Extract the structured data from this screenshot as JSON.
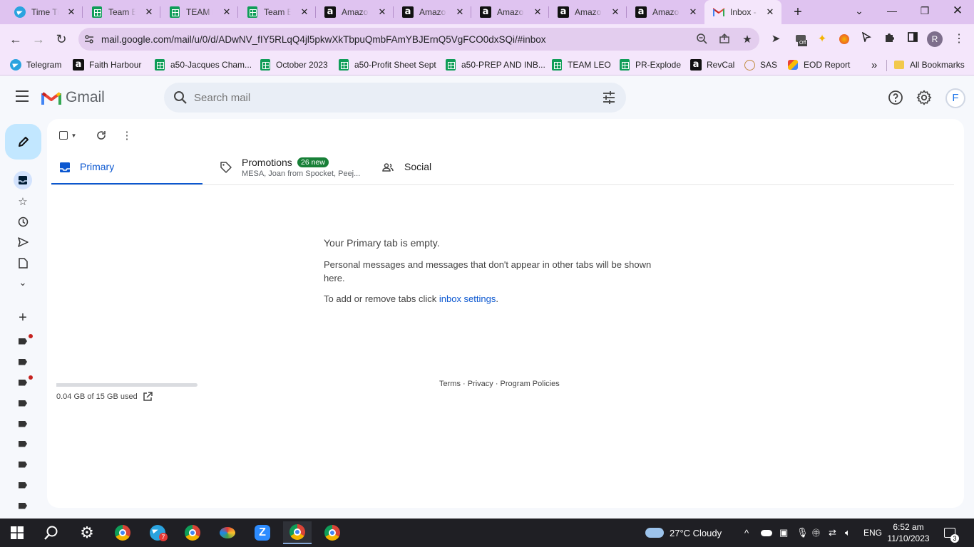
{
  "browser": {
    "tabs": [
      {
        "label": "Time Tr",
        "icon": "telegram-icon"
      },
      {
        "label": "Team Ex",
        "icon": "sheets-icon"
      },
      {
        "label": "TEAM L",
        "icon": "sheets-icon"
      },
      {
        "label": "Team Ex",
        "icon": "sheets-icon"
      },
      {
        "label": "Amazon",
        "icon": "amazon-icon"
      },
      {
        "label": "Amazon",
        "icon": "amazon-icon"
      },
      {
        "label": "Amazon",
        "icon": "amazon-icon"
      },
      {
        "label": "Amazon",
        "icon": "amazon-icon"
      },
      {
        "label": "Amazon",
        "icon": "amazon-icon"
      },
      {
        "label": "Inbox -",
        "icon": "gmail-icon",
        "active": true
      }
    ],
    "url": "mail.google.com/mail/u/0/d/ADwNV_fIY5RLqQ4jl5pkwXkTbpuQmbFAmYBJErnQ5VgFCO0dxSQi/#inbox",
    "profile_initial": "R",
    "extension_badge": "Off",
    "bookmarks": [
      {
        "label": "Telegram",
        "icon": "telegram-icon"
      },
      {
        "label": "Faith Harbour",
        "icon": "amazon-icon"
      },
      {
        "label": "a50-Jacques Cham...",
        "icon": "sheets-icon"
      },
      {
        "label": "October 2023",
        "icon": "sheets-icon"
      },
      {
        "label": "a50-Profit Sheet Sept",
        "icon": "sheets-icon"
      },
      {
        "label": "a50-PREP AND INB...",
        "icon": "sheets-icon"
      },
      {
        "label": "TEAM LEO",
        "icon": "sheets-icon"
      },
      {
        "label": "PR-Explode",
        "icon": "sheets-icon"
      },
      {
        "label": "RevCal",
        "icon": "amazon-icon"
      },
      {
        "label": "SAS",
        "icon": "sas-icon"
      },
      {
        "label": "EOD Report",
        "icon": "eod-icon"
      }
    ],
    "bookmarks_overflow": "»",
    "all_bookmarks": "All Bookmarks"
  },
  "gmail": {
    "logo_text": "Gmail",
    "search_placeholder": "Search mail",
    "avatar_initial": "F",
    "tabs": {
      "primary": "Primary",
      "promotions": "Promotions",
      "promotions_badge": "26 new",
      "promotions_subtitle": "MESA, Joan from Spocket, Peej...",
      "social": "Social"
    },
    "empty": {
      "title": "Your Primary tab is empty.",
      "body": "Personal messages and messages that don't appear in other tabs will be shown here.",
      "settings_prefix": "To add or remove tabs click ",
      "settings_link": "inbox settings",
      "settings_suffix": "."
    },
    "storage": {
      "text": "0.04 GB of 15 GB used",
      "used_fraction": 0.0027
    },
    "footer": "Terms · Privacy · Program Policies"
  },
  "taskbar": {
    "telegram_badge": "7",
    "weather": "27°C  Cloudy",
    "language": "ENG",
    "time": "6:52 am",
    "date": "11/10/2023",
    "notifications": "3"
  },
  "colors": {
    "tab_strip": "#dfc3f0",
    "accent": "#0b57d0",
    "compose": "#c2e7ff",
    "promo_badge": "#188038"
  }
}
